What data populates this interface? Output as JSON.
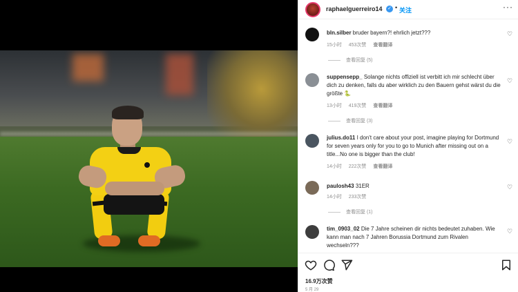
{
  "post": {
    "username": "raphaelguerreiro14",
    "verified_mark": "✓",
    "separator": "•",
    "follow_label": "关注",
    "more_label": "···",
    "likes": "16.9万次赞",
    "date": "5 月 29"
  },
  "comments": [
    {
      "username": "bln.silber",
      "text": "bruder bayern?! ehrlich jetzt???",
      "time": "15小时",
      "likes": "453次赞",
      "translate": "查看翻译",
      "replies": "查看回复 (5)",
      "avatar_color": "#111111"
    },
    {
      "username": "suppensepp_",
      "text": "Solange nichts offiziell ist verbitt ich mir schlecht über dich zu denken, falls du aber wirklich zu den Bauern gehst wärst du die größte 🐍",
      "time": "13小时",
      "likes": "419次赞",
      "translate": "查看翻译",
      "replies": "查看回复 (3)",
      "avatar_color": "#8a8f95"
    },
    {
      "username": "julius.do11",
      "text": "I don't care about your post, imagine playing for Dortmund for seven years only for you to go to Munich after missing out on a title...No one is bigger than the club!",
      "time": "14小时",
      "likes": "222次赞",
      "translate": "查看翻译",
      "replies": "",
      "avatar_color": "#4a5560"
    },
    {
      "username": "paulosh43",
      "text": "31ER",
      "time": "14小时",
      "likes": "233次赞",
      "translate": "",
      "replies": "查看回复 (1)",
      "avatar_color": "#7a6a58"
    },
    {
      "username": "tim_0903_02",
      "text": "Die 7 Jahre scheinen dir nichts bedeutet zuhaben. Wie kann man nach 7 Jahren Borussia Dortmund zum Rivalen wechseln???",
      "time": "",
      "likes": "",
      "translate": "",
      "replies": "",
      "avatar_color": "#3d3d3d"
    }
  ],
  "icons": {
    "heart": "heart-icon",
    "comment": "comment-icon",
    "share": "share-icon",
    "save": "bookmark-icon",
    "more": "more-icon"
  }
}
